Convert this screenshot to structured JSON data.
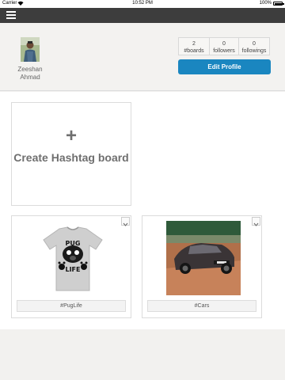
{
  "status_bar": {
    "carrier": "Carrier",
    "time": "10:52 PM",
    "battery": "100%",
    "wifi_icon": "wifi-icon",
    "battery_icon": "battery-icon"
  },
  "nav": {
    "menu_icon": "hamburger-menu-icon",
    "background": "#3d3d3d"
  },
  "profile": {
    "name": "Zeeshan Ahmad",
    "stats": [
      {
        "value": "2",
        "label": "#boards"
      },
      {
        "value": "0",
        "label": "followers"
      },
      {
        "value": "0",
        "label": "followings"
      }
    ],
    "edit_button": "Edit Profile",
    "accent": "#1a86c0"
  },
  "create_board": {
    "icon": "+",
    "label": "Create Hashtag board"
  },
  "boards": [
    {
      "tag": "#PugLife",
      "image": "pug-tshirt-image"
    },
    {
      "tag": "#Cars",
      "image": "car-photo-image"
    }
  ],
  "card_menu_icon": "chevron-down-icon"
}
